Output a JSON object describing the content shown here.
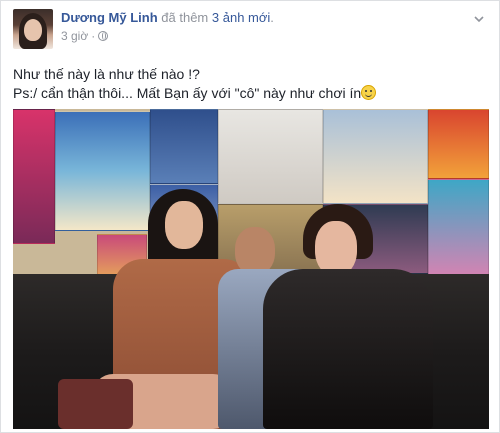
{
  "post": {
    "author": "Dương Mỹ Linh",
    "action_prefix": "đã thêm",
    "action_link": "3 ảnh mới",
    "action_suffix": ".",
    "time": "3 giờ",
    "separator": "·",
    "privacy_icon": "globe-icon",
    "menu_icon": "chevron-down-icon",
    "text_line1": "Như thế này là như thế nào !?",
    "text_line2": "Ps:/ cẩn thận thôi... Mất Bạn ấy với \"cô\" này như chơi ín",
    "emoji_icon": "smiley-icon"
  },
  "colors": {
    "link": "#365899",
    "muted": "#90949c",
    "text": "#1d2129",
    "border": "#dddfe2"
  }
}
